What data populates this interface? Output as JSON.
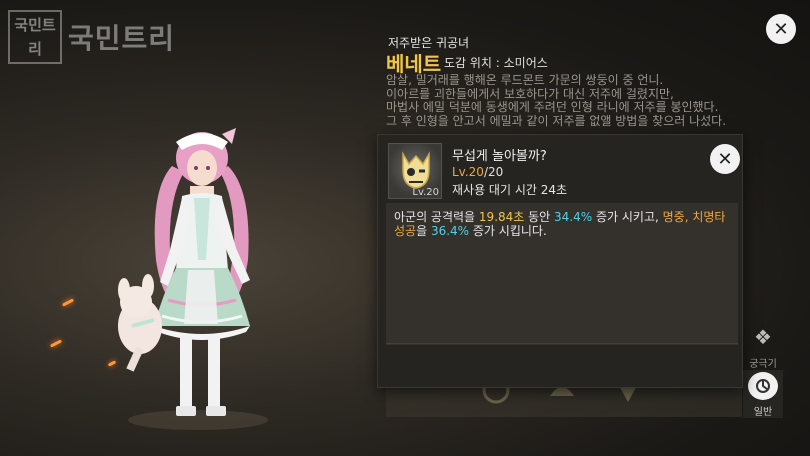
{
  "watermark": {
    "box_text": "국민트리",
    "text": "국민트리"
  },
  "character": {
    "subtitle": "저주받은 귀공녀",
    "name": "베네트",
    "location": "도감 위치 : 소미어스"
  },
  "lore_lines": [
    "암살, 밀거래를 행해온 루드몬트 가문의 쌍둥이 중 언니.",
    "이아르를 괴한들에게서 보호하다가 대신 저주에 걸렸지만,",
    "마법사 에밀 덕분에 동생에게 주려던 인형 라니에 저주를 봉인했다.",
    "그 후 인형을 안고서 에밀과 같이 저주를 없앨 방법을 찾으러 나섰다."
  ],
  "skill": {
    "name": "무섭게 놀아볼까?",
    "icon": "skull-cat-emblem-icon",
    "icon_level": "Lv.20",
    "level_current": "Lv.20",
    "level_max": "/20",
    "cooldown": "재사용 대기 시간 24초",
    "desc": {
      "p1": "아군의 공격력을 ",
      "v1": "19.84초",
      "p2": " 동안 ",
      "v2": "34.4%",
      "p3": " 증가 시키고, ",
      "v3": "명중, 치명타 성공",
      "p4": "을 ",
      "v4": "36.4%",
      "p5": " 증가 시킵니다."
    }
  },
  "side_buttons": [
    {
      "label": "궁극기",
      "icon": "sparkle-icon"
    },
    {
      "label": "일반",
      "icon": "skill-orb-icon"
    }
  ],
  "colors": {
    "highlight_yellow": "#f0c64a",
    "highlight_cyan": "#4fd2e6",
    "level_orange": "#f0a83c"
  }
}
